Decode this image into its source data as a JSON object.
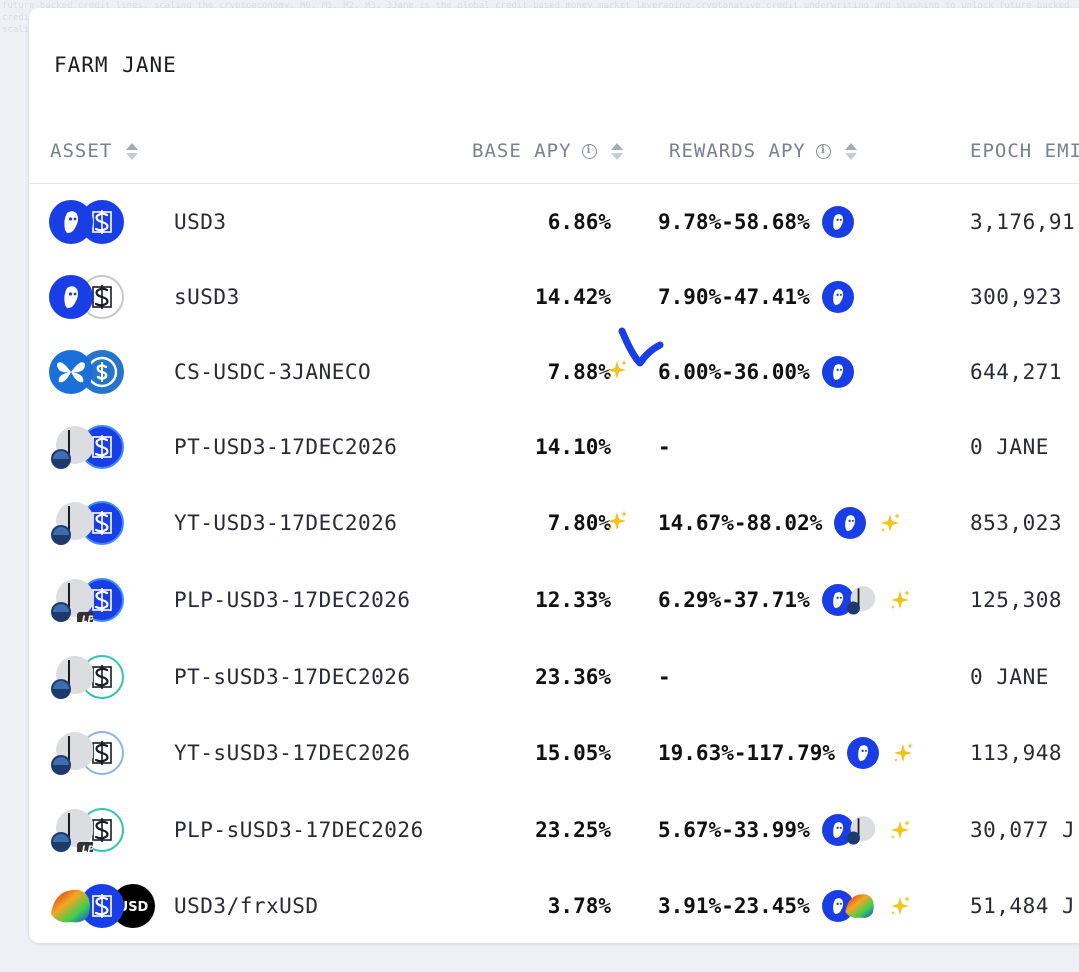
{
  "background_text": "future-backed credit lines, scaling the cryptoeconomy. M0, M1, M2, M3. 3Jane is the global credit-based money market leveraging cryptonative credit underwriting and slashing to unlock future-backed credit lines, scaling the cryptoeconomy. M0, M1, M2, M3. 3Jane is the global credit-based money market leveraging cryptonative credit underwriting and slashing to unlock future-backed credit lines, scaling the cryptoeconomy. M0, M1, M2, M3.",
  "title": "FARM JANE",
  "headers": {
    "asset": "ASSET",
    "base_apy": "BASE APY",
    "rewards_apy": "REWARDS APY",
    "epoch": "EPOCH EMI"
  },
  "info_glyph": "i",
  "lp_badge": "LP",
  "usd_badge": "USD",
  "colors": {
    "brand_blue": "#1a3ee6",
    "light_blue": "#3d8bfd",
    "teal": "#2ec4b6",
    "gold": "#f2c318",
    "navy": "#1e3a6d"
  },
  "rows": [
    {
      "asset": "USD3",
      "base": "6.86%",
      "base_sparkle": false,
      "rewards": "9.78%-58.68%",
      "reward_icons": [
        "jane"
      ],
      "reward_sparkle": false,
      "epoch": "3,176,91",
      "icons": [
        "jane",
        "usd3-blue"
      ]
    },
    {
      "asset": "sUSD3",
      "base": "14.42%",
      "base_sparkle": false,
      "rewards": "7.90%-47.41%",
      "reward_icons": [
        "jane"
      ],
      "reward_sparkle": false,
      "epoch": "300,923",
      "icons": [
        "jane",
        "susd3-white"
      ]
    },
    {
      "asset": "CS-USDC-3JANECO",
      "base": "7.88%",
      "base_sparkle": true,
      "rewards": "6.00%-36.00%",
      "reward_icons": [
        "jane"
      ],
      "reward_sparkle": false,
      "epoch": "644,271",
      "icons": [
        "butterfly",
        "usdc"
      ]
    },
    {
      "asset": "PT-USD3-17DEC2026",
      "base": "14.10%",
      "base_sparkle": false,
      "rewards": "-",
      "reward_icons": [],
      "reward_sparkle": false,
      "epoch": "0 JANE",
      "icons": [
        "pendle",
        "usd3-ring"
      ]
    },
    {
      "asset": "YT-USD3-17DEC2026",
      "base": "7.80%",
      "base_sparkle": true,
      "rewards": "14.67%-88.02%",
      "reward_icons": [
        "jane"
      ],
      "reward_sparkle": true,
      "epoch": "853,023",
      "icons": [
        "pendle",
        "usd3-ring"
      ]
    },
    {
      "asset": "PLP-USD3-17DEC2026",
      "base": "12.33%",
      "base_sparkle": false,
      "rewards": "6.29%-37.71%",
      "reward_icons": [
        "jane",
        "pendle"
      ],
      "reward_sparkle": true,
      "epoch": "125,308",
      "icons": [
        "pendle-lp",
        "usd3-ring"
      ]
    },
    {
      "asset": "PT-sUSD3-17DEC2026",
      "base": "23.36%",
      "base_sparkle": false,
      "rewards": "-",
      "reward_icons": [],
      "reward_sparkle": false,
      "epoch": "0 JANE",
      "icons": [
        "pendle",
        "susd3-teal"
      ]
    },
    {
      "asset": "YT-sUSD3-17DEC2026",
      "base": "15.05%",
      "base_sparkle": false,
      "rewards": "19.63%-117.79%",
      "reward_icons": [
        "jane"
      ],
      "reward_sparkle": true,
      "epoch": "113,948",
      "icons": [
        "pendle",
        "susd3-lightblue"
      ]
    },
    {
      "asset": "PLP-sUSD3-17DEC2026",
      "base": "23.25%",
      "base_sparkle": false,
      "rewards": "5.67%-33.99%",
      "reward_icons": [
        "jane",
        "pendle"
      ],
      "reward_sparkle": true,
      "epoch": "30,077 J",
      "icons": [
        "pendle-lp",
        "susd3-teal"
      ]
    },
    {
      "asset": "USD3/frxUSD",
      "base": "3.78%",
      "base_sparkle": false,
      "rewards": "3.91%-23.45%",
      "reward_icons": [
        "jane",
        "curve"
      ],
      "reward_sparkle": true,
      "epoch": "51,484 J",
      "icons": [
        "curve",
        "usd3-blue",
        "usd-black"
      ]
    }
  ]
}
